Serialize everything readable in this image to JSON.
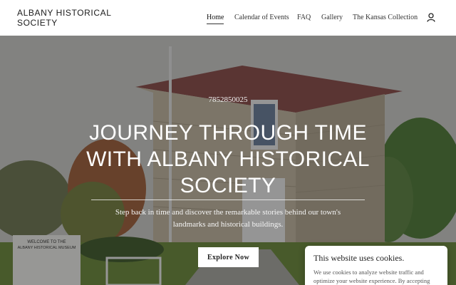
{
  "site": {
    "title": "ALBANY HISTORICAL SOCIETY"
  },
  "nav": {
    "items": [
      {
        "label": "Home",
        "active": true
      },
      {
        "label": "Calendar of Events",
        "active": false
      },
      {
        "label": "FAQ",
        "active": false
      },
      {
        "label": "Gallery",
        "active": false
      },
      {
        "label": "The Kansas Collection",
        "active": false
      }
    ],
    "account_icon": "user-icon"
  },
  "hero": {
    "phone": "7852850025",
    "headline": "JOURNEY THROUGH TIME WITH ALBANY HISTORICAL SOCIETY",
    "tagline": "Step back in time and discover the remarkable stories behind our town's landmarks and historical buildings.",
    "cta_label": "Explore Now",
    "sign_text": [
      "WELCOME TO THE",
      "ALBANY HISTORICAL MUSEUM"
    ]
  },
  "cookie_banner": {
    "title": "This website uses cookies.",
    "text": "We use cookies to analyze website traffic and optimize your website experience. By accepting our"
  },
  "colors": {
    "header_bg": "#ffffff",
    "text_dark": "#1b1b1b",
    "button_bg": "#ffffff",
    "overlay": "rgba(25,25,25,0.42)"
  }
}
